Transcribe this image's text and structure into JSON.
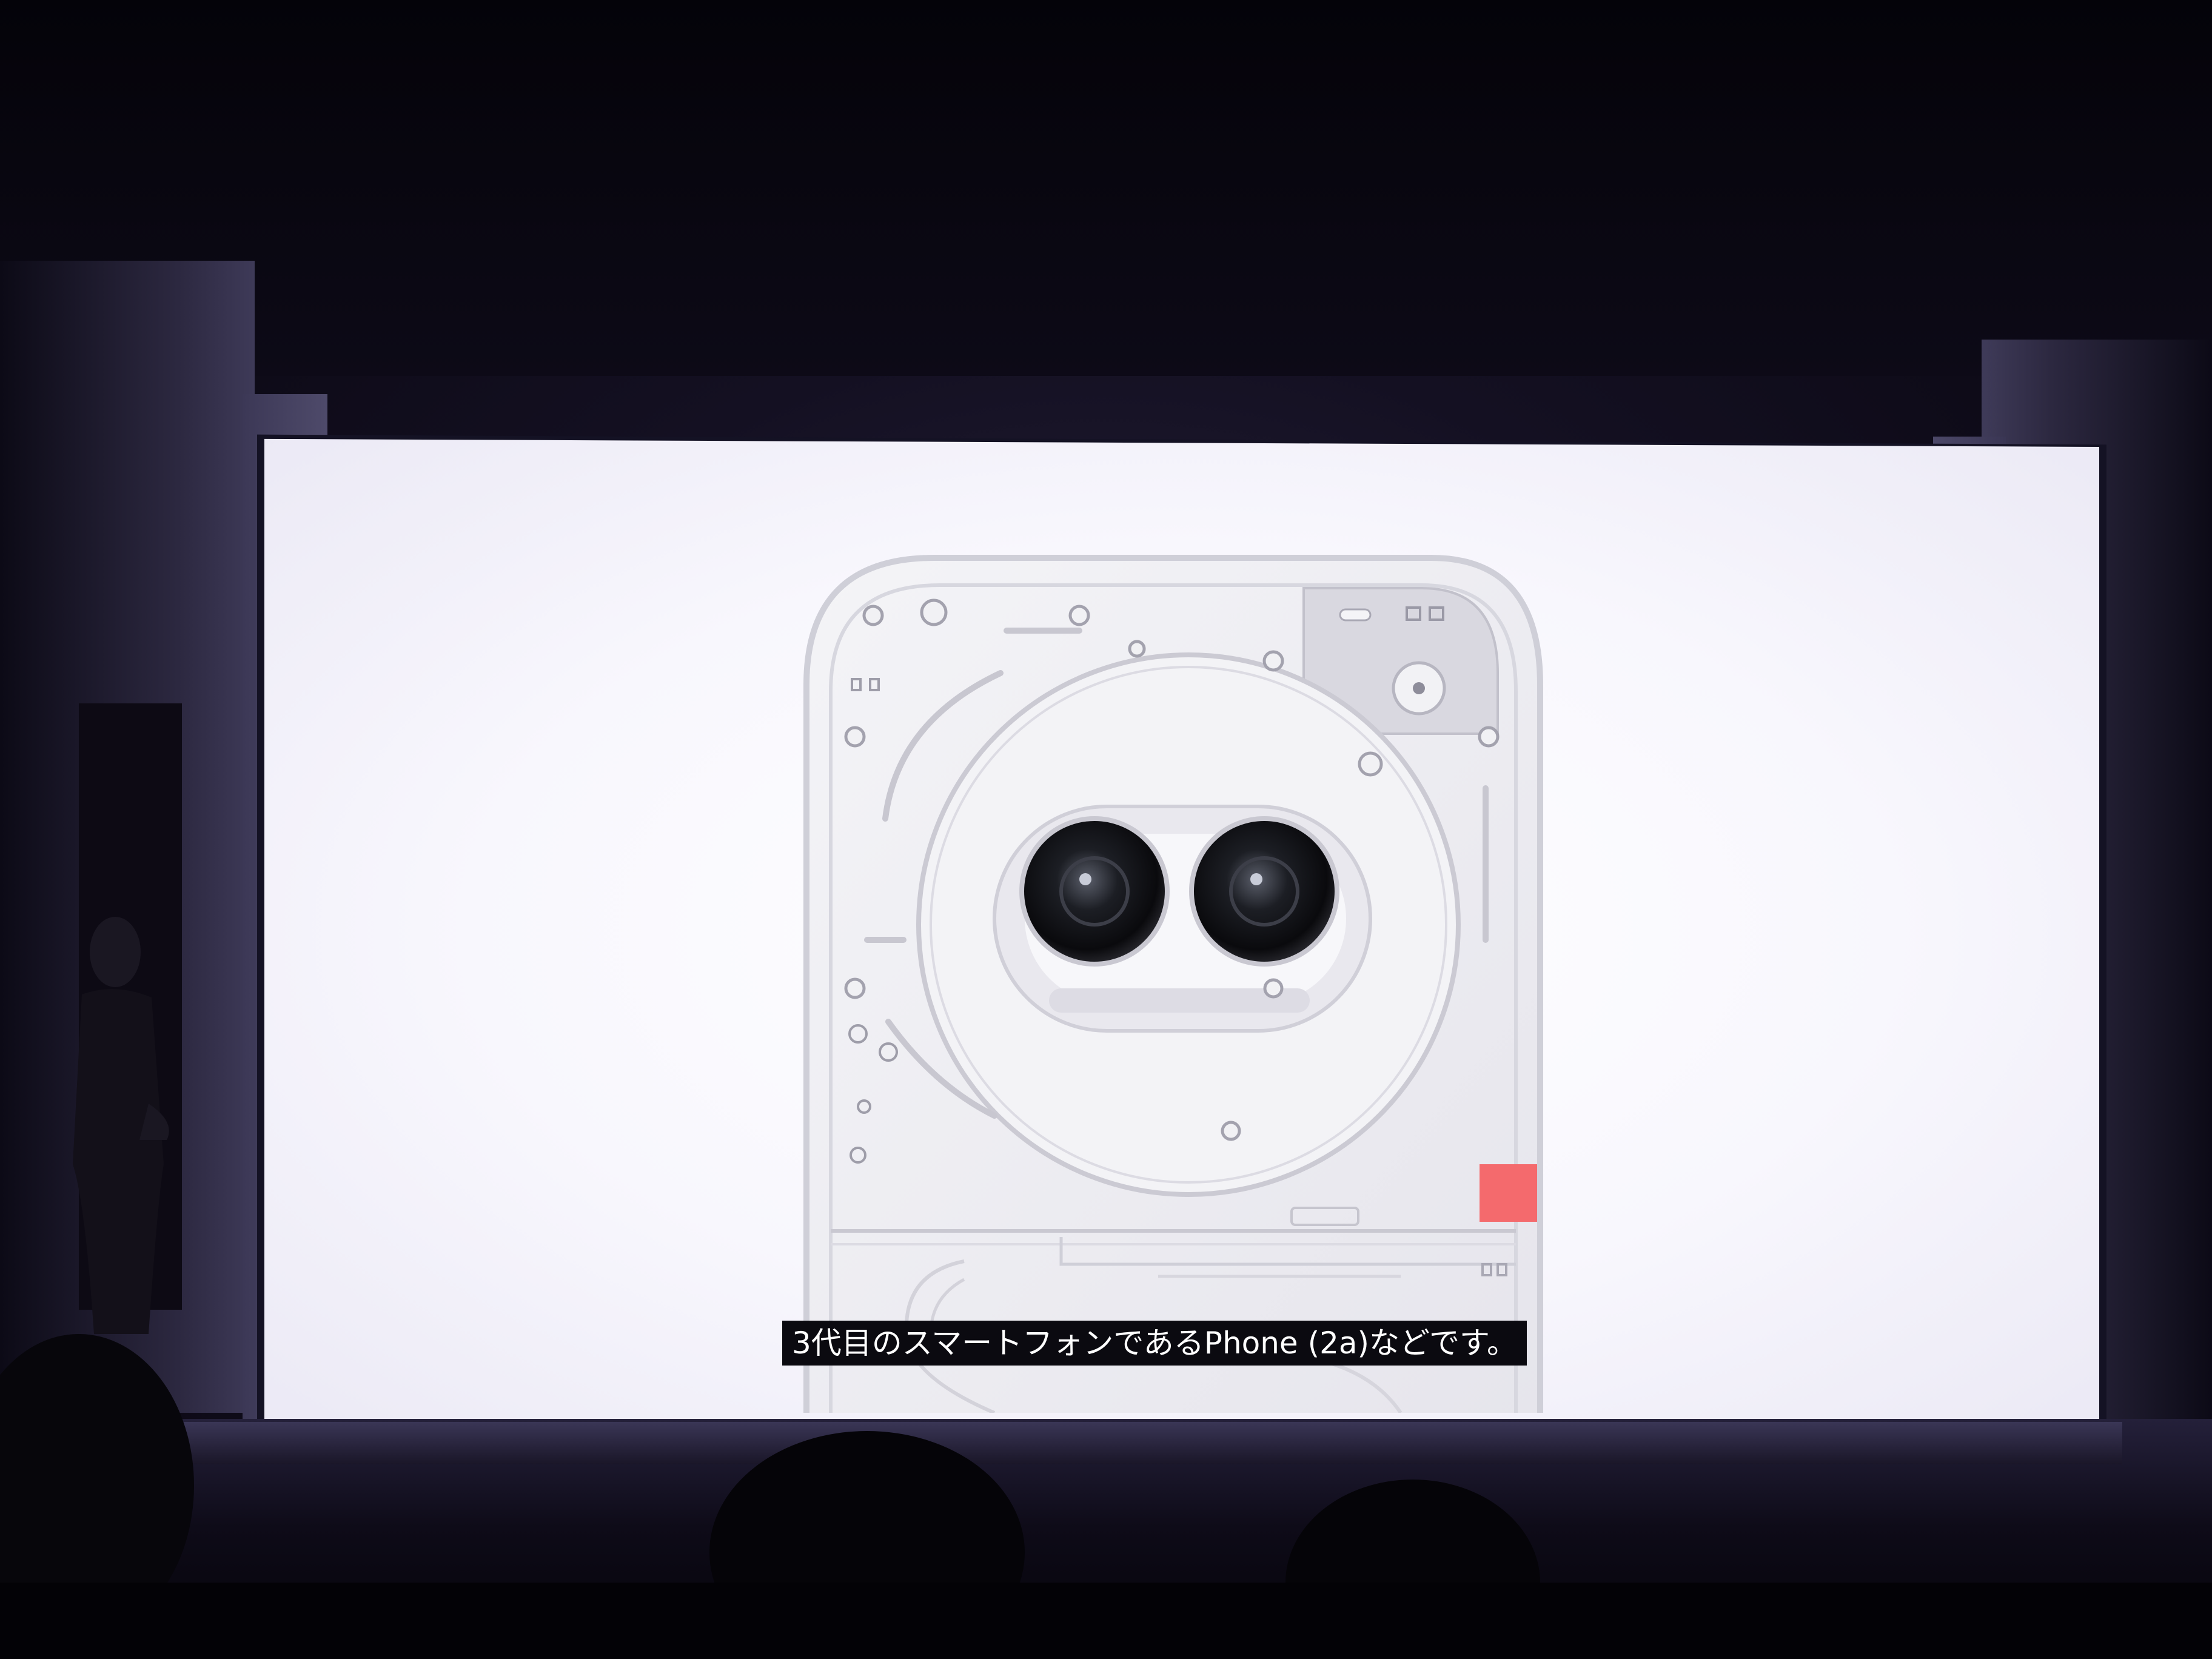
{
  "subtitle": {
    "text": "3代目のスマートフォンであるPhone (2a)などです。"
  },
  "colors": {
    "projection_background": "#f8f7fd",
    "phone_body": "#efeff3",
    "accent_square": "#f46a6d",
    "subtitle_background": "#0b0a10",
    "subtitle_text": "#ffffff"
  },
  "icons": {
    "camera_module": "dual-camera-icon",
    "accent": "red-square-icon"
  }
}
